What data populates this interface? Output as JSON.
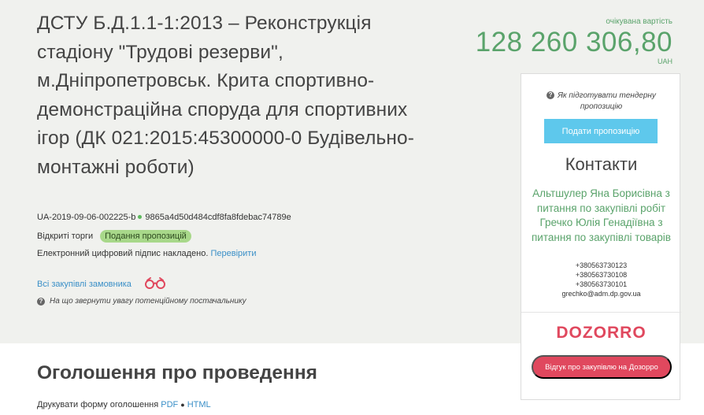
{
  "tender": {
    "title": "ДСТУ Б.Д.1.1-1:2013 – Реконструкція стадіону \"Трудові резерви\", м.Дніпропетровськ. Крита спортивно-демонстраційна споруда для спортивних ігор (ДК 021:2015:45300000-0 Будівельно-монтажні роботи)",
    "id": "UA-2019-09-06-002225-b",
    "hash": "9865a4d50d484cdf8fa8fdebac74789e",
    "procedure_type": "Відкриті торги",
    "status_badge": "Подання пропозицій",
    "signature_text": "Електронний цифровий підпис накладено.",
    "verify_link": "Перевірити",
    "all_purchases_link": "Всі закупівлі замовника",
    "attention_note": "На що звернути увагу потенційному постачальнику"
  },
  "price": {
    "label": "очікувана вартість",
    "amount": "128 260 306,80",
    "currency": "UAH"
  },
  "side_panel": {
    "how_prepare": "Як підготувати тендерну пропозицію",
    "submit_button": "Подати пропозицію",
    "contacts_title": "Контакти",
    "contact_names": "Альтшулер Яна Борисівна з питання по закупівлі робіт Гречко Юлія Генадіївна з питання по закупівлі товарів",
    "phones": [
      "+380563730123",
      "+380563730108",
      "+380563730101"
    ],
    "email": "grechko@adm.dp.gov.ua",
    "dozorro_logo": "DOZORRO",
    "dozorro_button": "Відгук про закупівлю на Дозорро"
  },
  "announcement": {
    "title": "Оголошення про проведення",
    "print_label": "Друкувати форму оголошення",
    "pdf_link": "PDF",
    "html_link": "HTML"
  },
  "colors": {
    "accent_green": "#5aa36b",
    "link_blue": "#3a8fc7",
    "button_blue": "#5ec8ec",
    "dozorro_red": "#e0485e",
    "badge_green": "#a8d88a"
  },
  "icons": [
    "question-icon",
    "binoculars-icon",
    "status-dot-icon"
  ]
}
